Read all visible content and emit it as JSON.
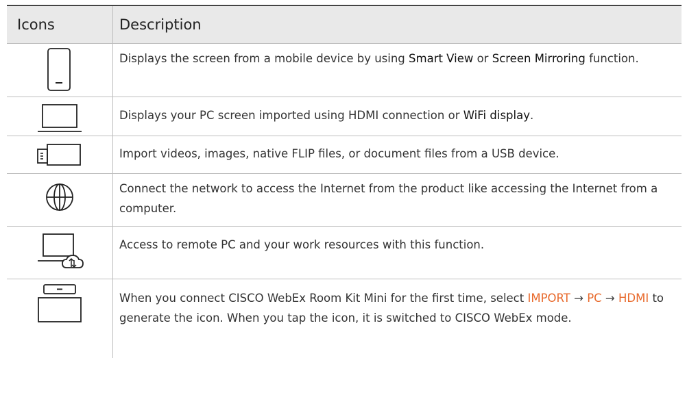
{
  "header": {
    "icons": "Icons",
    "description": "Description"
  },
  "rows": [
    {
      "icon": "mobile-device-icon",
      "desc": {
        "pre": "Displays the screen from a mobile device by using ",
        "smart_view": "Smart View",
        "or": " or ",
        "screen_mirroring": "Screen Mirroring",
        "post": " function."
      }
    },
    {
      "icon": "laptop-icon",
      "desc": {
        "pre": "Displays your PC screen imported using HDMI connection or ",
        "wifi": "WiFi display",
        "post": "."
      }
    },
    {
      "icon": "usb-device-icon",
      "desc": {
        "text": "Import videos, images, native FLIP files, or document files from a USB device."
      }
    },
    {
      "icon": "globe-icon",
      "desc": {
        "text": "Connect the network to access the Internet from the product like accessing the Internet from a computer."
      }
    },
    {
      "icon": "remote-pc-icon",
      "desc": {
        "text": "Access to remote PC and your work resources with this function."
      }
    },
    {
      "icon": "webex-room-kit-icon",
      "desc": {
        "pre": "When you connect CISCO WebEx Room Kit Mini for the first time, select ",
        "import": "IMPORT",
        "arrow1": " → ",
        "pc": "PC",
        "arrow2": " → ",
        "hdmi": "HDMI",
        "post": " to generate the icon. When you tap the icon, it is switched to CISCO WebEx mode."
      }
    }
  ],
  "colors": {
    "highlight_orange": "#e8692b",
    "header_bg": "#e9e9e9",
    "rule": "#bdbdbd"
  }
}
